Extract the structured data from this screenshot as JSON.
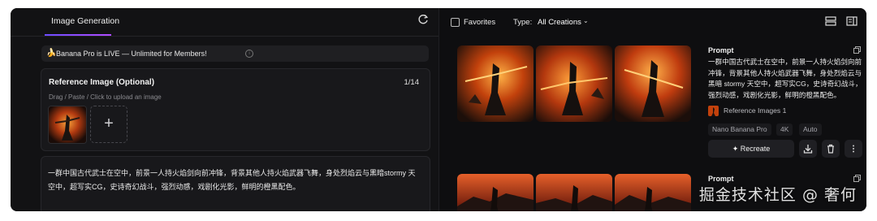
{
  "left": {
    "tab_label": "Image Generation",
    "banner": {
      "emoji": "🍌",
      "text": "Banana Pro is LIVE — Unlimited for Members!"
    },
    "reference": {
      "title": "Reference Image (Optional)",
      "count": "1/14",
      "hint": "Drag / Paste / Click to upload an image",
      "add_symbol": "+"
    },
    "prompt_text": "一群中国古代武士在空中，前景一人持火焰剑向前冲锋，背景其他人持火焰武器飞舞，身处烈焰云与黑暗stormy 天空中，超写实CG，史诗奇幻战斗，强烈动感，戏剧化光影，鲜明的橙黑配色。"
  },
  "toolbar": {
    "favorites_label": "Favorites",
    "type_label": "Type:",
    "type_value": "All Creations"
  },
  "creations": [
    {
      "prompt_label": "Prompt",
      "prompt_text": "一群中国古代武士在空中，前景一人持火焰剑向前冲锋，背景其他人持火焰武器飞舞，身处烈焰云与黑暗 stormy 天空中，超写实CG，史诗奇幻战斗，强烈动感，戏剧化光影，鲜明的橙黑配色。",
      "reference_images": "Reference Images 1",
      "tags": [
        "Nano Banana Pro",
        "4K",
        "Auto"
      ],
      "recreate_label": "Recreate"
    },
    {
      "prompt_label": "Prompt"
    }
  ],
  "watermark": "掘金技术社区 @ 奢何",
  "colors": {
    "accent_start": "#6d4cff",
    "accent_end": "#b04cff",
    "panel_bg": "#121214"
  }
}
